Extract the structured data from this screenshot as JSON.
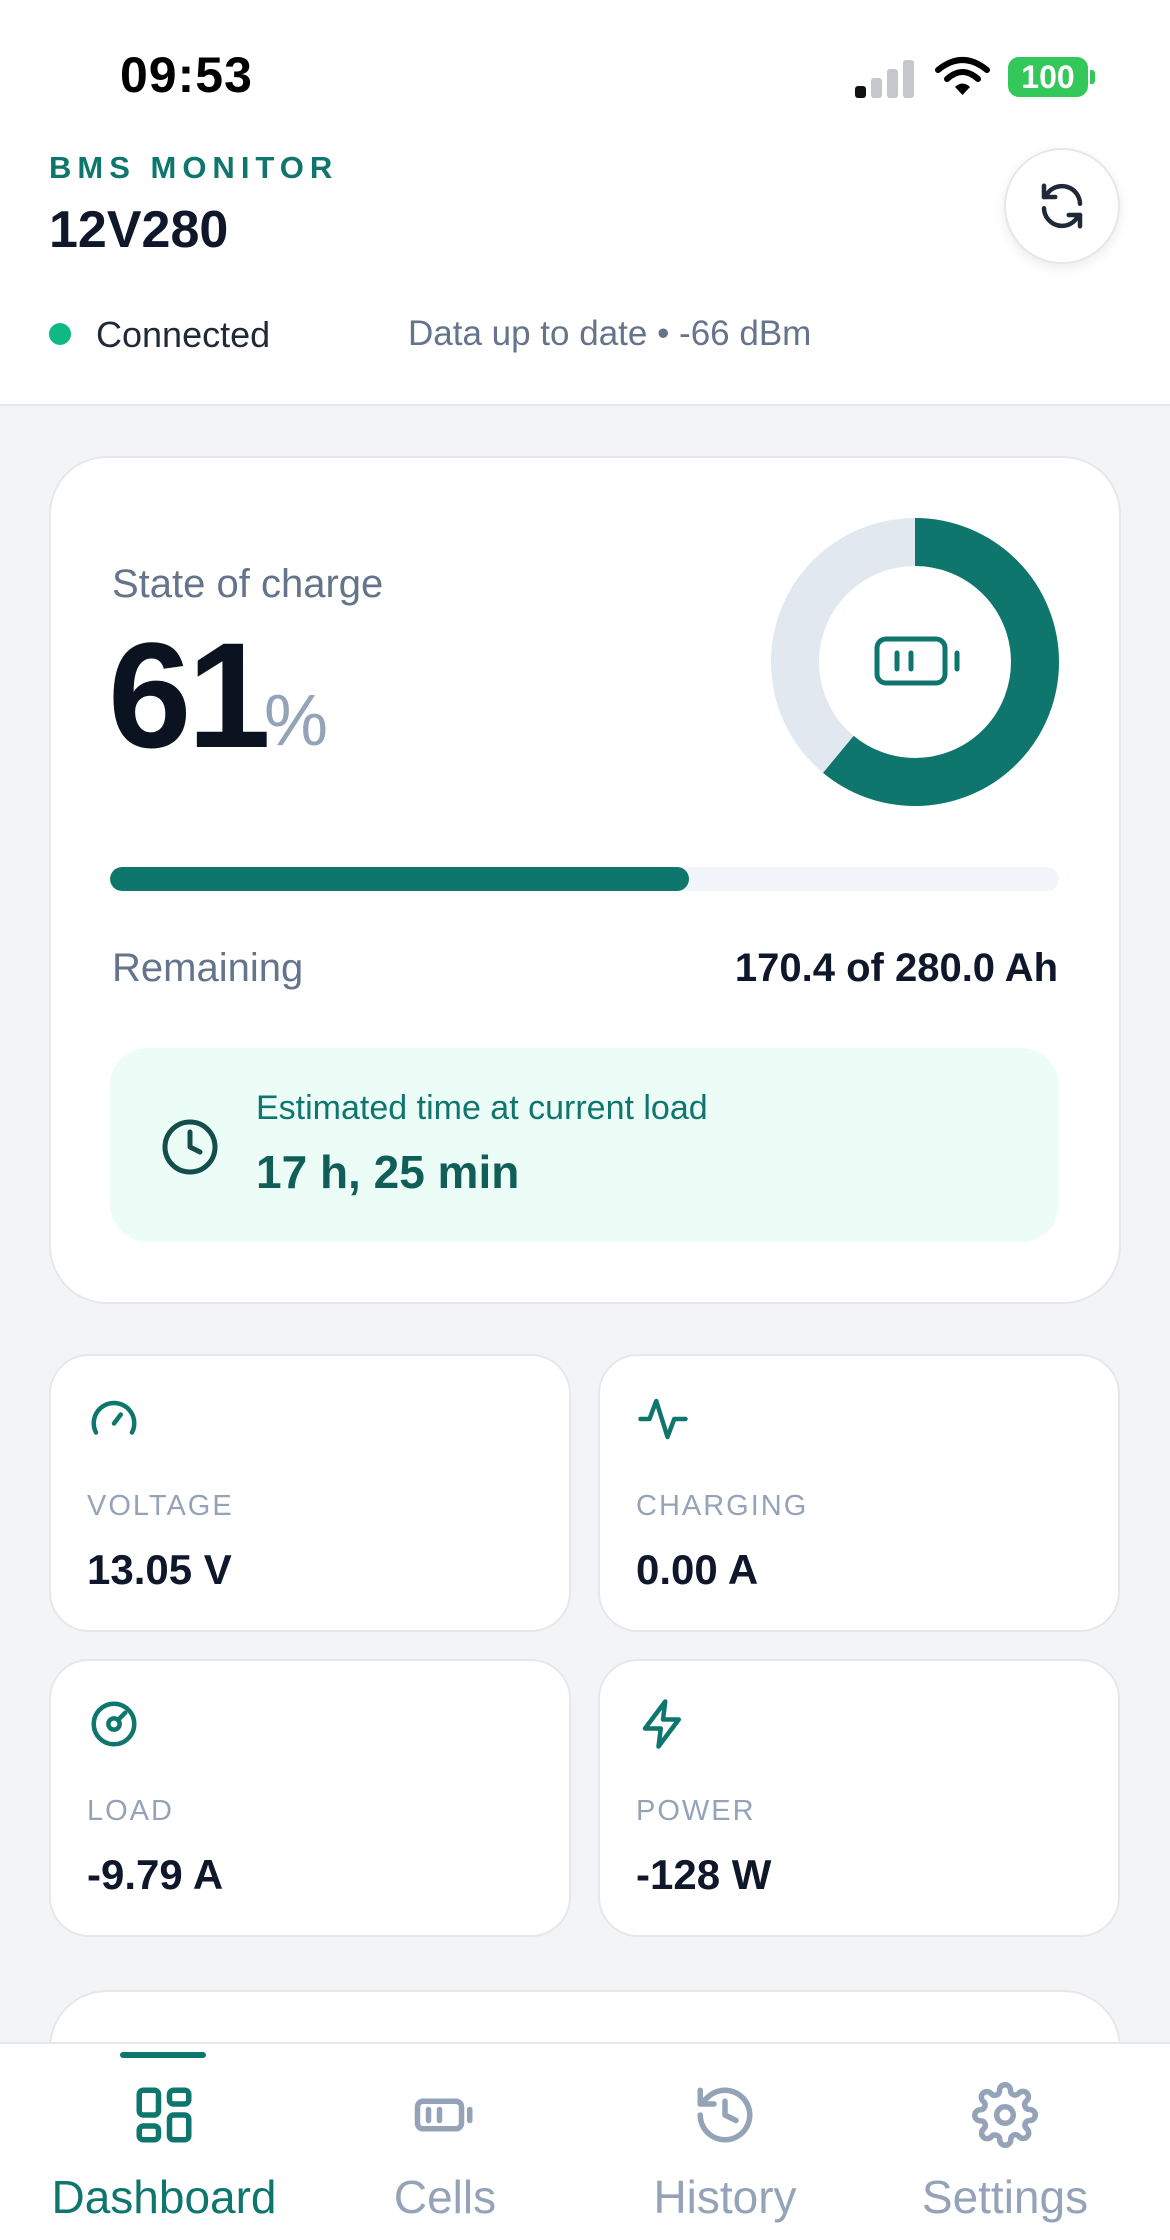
{
  "status_bar": {
    "time": "09:53",
    "battery": "100"
  },
  "header": {
    "app_label": "BMS MONITOR",
    "device_name": "12V280",
    "refresh_icon": "refresh-icon",
    "connection_status": "Connected",
    "connection_info": "Data up to date • -66 dBm"
  },
  "soc": {
    "title": "State of charge",
    "value": "61",
    "unit": "%",
    "fraction": 0.61,
    "remaining_label": "Remaining",
    "remaining_value": "170.4 of 280.0 Ah",
    "eta_label": "Estimated time at current load",
    "eta_value": "17 h, 25 min",
    "eta_icon": "clock-icon",
    "center_icon": "battery-icon"
  },
  "metrics": [
    {
      "label": "VOLTAGE",
      "value": "13.05 V",
      "icon": "gauge-icon"
    },
    {
      "label": "CHARGING",
      "value": "0.00 A",
      "icon": "activity-icon"
    },
    {
      "label": "LOAD",
      "value": "-9.79 A",
      "icon": "target-icon"
    },
    {
      "label": "POWER",
      "value": "-128 W",
      "icon": "lightning-icon"
    }
  ],
  "tabs": [
    {
      "label": "Dashboard",
      "icon": "dashboard-icon",
      "active": true
    },
    {
      "label": "Cells",
      "icon": "battery-icon",
      "active": false
    },
    {
      "label": "History",
      "icon": "history-icon",
      "active": false
    },
    {
      "label": "Settings",
      "icon": "gear-icon",
      "active": false
    }
  ],
  "colors": {
    "accent": "#0f766e",
    "connected": "#10b981",
    "muted": "#94a3b8",
    "track": "#e2e8f0"
  }
}
